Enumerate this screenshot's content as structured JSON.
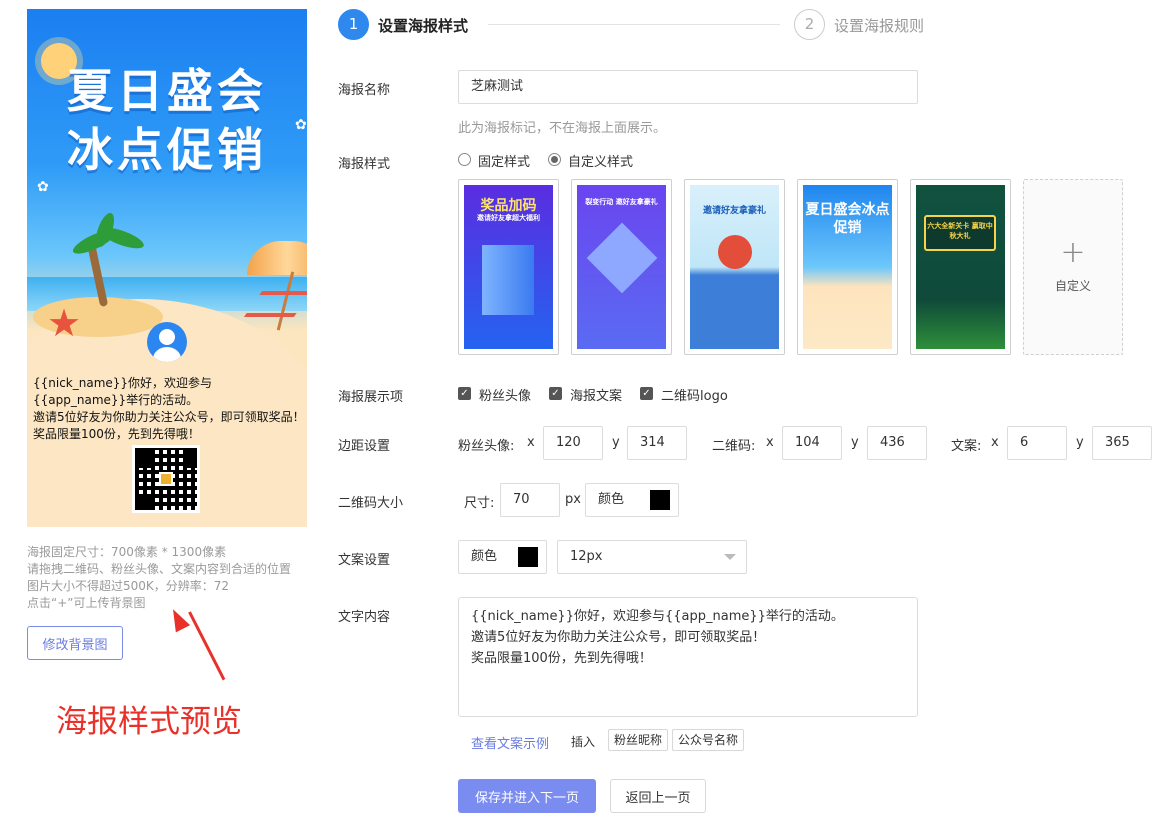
{
  "preview": {
    "title_line1": "夏日盛会",
    "title_line2": "冰点促销",
    "text_line1": "{{nick_name}}你好，欢迎参与{{app_name}}举行的活动。",
    "text_line2": "邀请5位好友为你助力关注公众号，即可领取奖品！",
    "text_line3": "奖品限量100份，先到先得哦！"
  },
  "help": {
    "line1": "海报固定尺寸：700像素 * 1300像素",
    "line2": "请拖拽二维码、粉丝头像、文案内容到合适的位置",
    "line3": "图片大小不得超过500K，分辨率：72",
    "line4": "点击“+”可上传背景图"
  },
  "buttons": {
    "change_bg": "修改背景图",
    "save_next": "保存并进入下一页",
    "back": "返回上一页"
  },
  "annotation": "海报样式预览",
  "steps": [
    {
      "num": "1",
      "label": "设置海报样式"
    },
    {
      "num": "2",
      "label": "设置海报规则"
    }
  ],
  "form": {
    "name_label": "海报名称",
    "name_value": "芝麻测试",
    "name_hint": "此为海报标记，不在海报上面展示。",
    "style_label": "海报样式",
    "style_fixed": "固定样式",
    "style_custom": "自定义样式",
    "templates": [
      {
        "title": "奖品加码",
        "sub": "邀请好友拿超大福利"
      },
      {
        "title": "裂变行动 邀好友拿豪礼",
        "sub": ""
      },
      {
        "title": "邀请好友拿豪礼",
        "sub": ""
      },
      {
        "title": "夏日盛会冰点促销",
        "sub": ""
      },
      {
        "title": "六大全新关卡 赢取中秋大礼",
        "sub": ""
      }
    ],
    "custom_add": "自定义",
    "show_label": "海报展示项",
    "show_items": [
      "粉丝头像",
      "海报文案",
      "二维码logo"
    ],
    "margin_label": "边距设置",
    "margin": {
      "avatar_label": "粉丝头像:",
      "qr_label": "二维码:",
      "text_label": "文案:",
      "x": "x",
      "y": "y",
      "avatar_x": "120",
      "avatar_y": "314",
      "qr_x": "104",
      "qr_y": "436",
      "text_x": "6",
      "text_y": "365"
    },
    "qr_label": "二维码大小",
    "qr_size_label": "尺寸:",
    "qr_size_value": "70",
    "qr_unit": "px",
    "qr_color_label": "颜色",
    "qr_color": "#000000",
    "text_settings_label": "文案设置",
    "text_color_label": "颜色",
    "text_color": "#000000",
    "font_size": "12px",
    "content_label": "文字内容",
    "content_line1": "{{nick_name}}你好，欢迎参与{{app_name}}举行的活动。",
    "content_line2": "邀请5位好友为你助力关注公众号，即可领取奖品！",
    "content_line3": "奖品限量100份，先到先得哦！",
    "example_link": "查看文案示例",
    "insert_label": "插入",
    "insert_tags": [
      "粉丝昵称",
      "公众号名称"
    ]
  },
  "colors": {
    "primary": "#2f88ee",
    "button_primary": "#7b8cf0",
    "link": "#6a7ce0",
    "annotation": "#e8312a"
  }
}
